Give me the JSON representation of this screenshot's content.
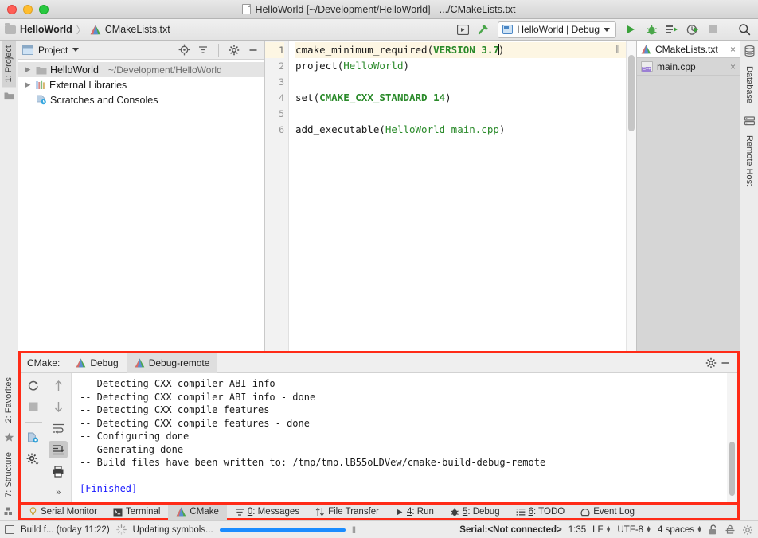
{
  "window": {
    "title": "HelloWorld [~/Development/HelloWorld] - .../CMakeLists.txt",
    "doc_icon": "document-icon",
    "traffic_lights": [
      "close",
      "minimize",
      "maximize"
    ]
  },
  "navbar": {
    "breadcrumb": {
      "project": "HelloWorld",
      "separator": "〉",
      "file": "CMakeLists.txt"
    },
    "buttons": [
      {
        "name": "terminal-toggle-icon",
        "label": ""
      },
      {
        "name": "build-hammer-icon",
        "label": ""
      }
    ],
    "run_config": {
      "label": "HelloWorld | Debug",
      "icon": "run-config-icon"
    },
    "actions": [
      {
        "name": "run-icon",
        "label": "Run"
      },
      {
        "name": "debug-icon",
        "label": "Debug"
      },
      {
        "name": "attach-profiler-icon",
        "label": "Attach"
      },
      {
        "name": "run-coverage-icon",
        "label": "Coverage"
      },
      {
        "name": "stop-icon",
        "label": "Stop"
      },
      {
        "name": "search-icon",
        "label": "Search"
      }
    ]
  },
  "left_strip": [
    {
      "num": "1",
      "label": ": Project",
      "icon": "folder-icon",
      "active": true
    },
    {
      "num": "2",
      "label": ": Favorites",
      "icon": "star-icon",
      "active": false
    },
    {
      "num": "7",
      "label": ": Structure",
      "icon": "structure-icon",
      "active": false
    }
  ],
  "right_strip": [
    {
      "label": "Database",
      "icon": "database-icon"
    },
    {
      "label": "Remote Host",
      "icon": "remote-host-icon"
    }
  ],
  "project_panel": {
    "title": "Project",
    "header_icons": [
      "locate-icon",
      "collapse-all-icon",
      "settings-gear-icon",
      "hide-icon"
    ],
    "tree": [
      {
        "twist": "▶",
        "icon": "folder-icon",
        "label": "HelloWorld",
        "path": "~/Development/HelloWorld",
        "selected": true,
        "indent": 0
      },
      {
        "twist": "▶",
        "icon": "library-icon",
        "label": "External Libraries",
        "path": "",
        "selected": false,
        "indent": 0
      },
      {
        "twist": "",
        "icon": "scratches-icon",
        "label": "Scratches and Consoles",
        "path": "",
        "selected": false,
        "indent": 0
      }
    ]
  },
  "editor": {
    "line_numbers": [
      "1",
      "2",
      "3",
      "4",
      "5",
      "6"
    ],
    "current_line": 1,
    "pause_marker": "Ⅱ",
    "lines": [
      [
        {
          "t": "cmake_minimum_required",
          "c": "fn"
        },
        {
          "t": "(",
          "c": "paren"
        },
        {
          "t": "VERSION",
          "c": "kw"
        },
        {
          "t": " ",
          "c": "plain"
        },
        {
          "t": "3.7",
          "c": "num"
        },
        {
          "t": "CARET",
          "c": "caret"
        },
        {
          "t": ")",
          "c": "paren"
        }
      ],
      [
        {
          "t": "project",
          "c": "fn"
        },
        {
          "t": "(",
          "c": "paren"
        },
        {
          "t": "HelloWorld",
          "c": "str"
        },
        {
          "t": ")",
          "c": "paren"
        }
      ],
      [],
      [
        {
          "t": "set",
          "c": "fn"
        },
        {
          "t": "(",
          "c": "paren"
        },
        {
          "t": "CMAKE_CXX_STANDARD",
          "c": "kw"
        },
        {
          "t": " ",
          "c": "plain"
        },
        {
          "t": "14",
          "c": "num"
        },
        {
          "t": ")",
          "c": "paren"
        }
      ],
      [],
      [
        {
          "t": "add_executable",
          "c": "fn"
        },
        {
          "t": "(",
          "c": "paren"
        },
        {
          "t": "HelloWorld main.cpp",
          "c": "str"
        },
        {
          "t": ")",
          "c": "paren"
        }
      ]
    ]
  },
  "editor_tabs": [
    {
      "label": "CMakeLists.txt",
      "icon": "cmake-file-icon",
      "active": true,
      "close": "×"
    },
    {
      "label": "main.cpp",
      "icon": "cpp-file-icon",
      "active": false,
      "close": "×"
    }
  ],
  "cmake_panel": {
    "label": "CMake:",
    "tabs": [
      {
        "label": "Debug",
        "icon": "cmake-icon",
        "active": false
      },
      {
        "label": "Debug-remote",
        "icon": "cmake-icon",
        "active": true
      }
    ],
    "header_icons": [
      "settings-gear-icon",
      "hide-icon"
    ],
    "toolbar_left": [
      "rerun-cmake-icon",
      "stop-icon",
      "cmake-settings-icon",
      "gear-dropdown-icon"
    ],
    "toolbar_right": [
      "up-arrow-icon",
      "down-arrow-icon",
      "soft-wrap-icon",
      "scroll-to-end-icon",
      "print-icon",
      "expand-more-icon"
    ],
    "console_lines": [
      {
        "text": "-- Detecting CXX compiler ABI info",
        "style": "plain"
      },
      {
        "text": "-- Detecting CXX compiler ABI info - done",
        "style": "plain"
      },
      {
        "text": "-- Detecting CXX compile features",
        "style": "plain"
      },
      {
        "text": "-- Detecting CXX compile features - done",
        "style": "plain"
      },
      {
        "text": "-- Configuring done",
        "style": "plain"
      },
      {
        "text": "-- Generating done",
        "style": "plain"
      },
      {
        "text": "-- Build files have been written to: /tmp/tmp.lB55oLDVew/cmake-build-debug-remote",
        "style": "plain"
      },
      {
        "text": "",
        "style": "plain"
      },
      {
        "text": "[Finished]",
        "style": "finished"
      }
    ]
  },
  "bottom_tabs": [
    {
      "icon": "serial-monitor-icon",
      "num": "",
      "label": "Serial Monitor",
      "active": false
    },
    {
      "icon": "terminal-icon",
      "num": "",
      "label": "Terminal",
      "active": false
    },
    {
      "icon": "cmake-icon",
      "num": "",
      "label": "CMake",
      "active": true
    },
    {
      "icon": "messages-icon",
      "num": "0",
      "label": ": Messages",
      "active": false
    },
    {
      "icon": "file-transfer-icon",
      "num": "",
      "label": "File Transfer",
      "active": false
    },
    {
      "icon": "run-icon",
      "num": "4",
      "label": ": Run",
      "active": false
    },
    {
      "icon": "debug-icon",
      "num": "5",
      "label": ": Debug",
      "active": false
    },
    {
      "icon": "todo-icon",
      "num": "6",
      "label": ": TODO",
      "active": false
    },
    {
      "icon": "event-log-icon",
      "num": "",
      "label": "Event Log",
      "active": false
    }
  ],
  "statusbar": {
    "left_icon": "show-tool-windows-icon",
    "message": "Build f... (today 11:22)",
    "progress_label": "Updating symbols...",
    "progress_percent": 100,
    "pause_icon": "Ⅱ",
    "serial": "Serial:<Not connected>",
    "caret_position": "1:35",
    "line_separator": "LF",
    "encoding": "UTF-8",
    "indent": "4 spaces",
    "icons": [
      "lock-open-icon",
      "inspection-icon",
      "settings-gear-icon"
    ]
  },
  "colors": {
    "highlight_border": "#ff2b17",
    "keyword_green": "#2a8a2a",
    "progress_blue": "#1a8cff",
    "finished_blue": "#1a1aff",
    "current_line": "#fdf6e3"
  }
}
